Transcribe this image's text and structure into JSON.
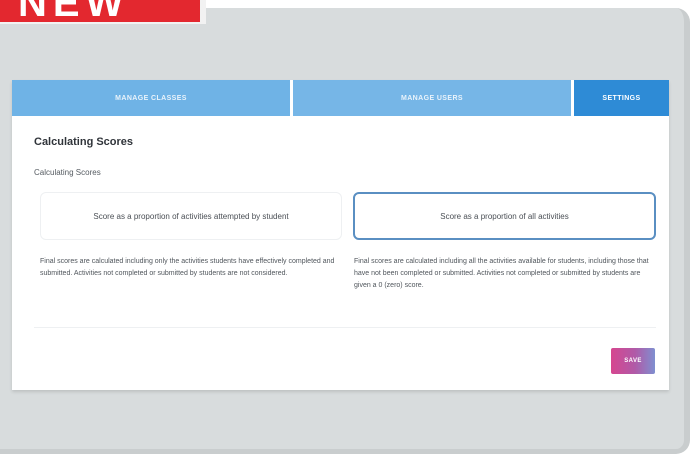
{
  "badge": {
    "label": "NEW",
    "color": "#e3282f"
  },
  "tabs": [
    {
      "label": "MANAGE CLASSES",
      "active": false
    },
    {
      "label": "MANAGE USERS",
      "active": false
    },
    {
      "label": "SETTINGS",
      "active": true
    }
  ],
  "settings": {
    "title": "Calculating Scores",
    "subtitle": "Calculating Scores",
    "options": [
      {
        "label": "Score as a proportion of activities attempted by student",
        "selected": false,
        "description": "Final scores are calculated including only the activities students have effectively completed and submitted. Activities not completed or submitted by students are not considered."
      },
      {
        "label": "Score as a proportion of all activities",
        "selected": true,
        "description": "Final scores are calculated including all the activities available for students, including those that have not been completed or submitted. Activities not completed or submitted by students are given a 0 (zero) score."
      }
    ],
    "save_label": "SAVE"
  },
  "colors": {
    "tab_active": "#2e8bd6",
    "tab_inactive": "#6fb3e6",
    "selected_border": "#5a8fc2",
    "save_gradient_start": "#d6468f",
    "save_gradient_end": "#7f8fd0"
  }
}
